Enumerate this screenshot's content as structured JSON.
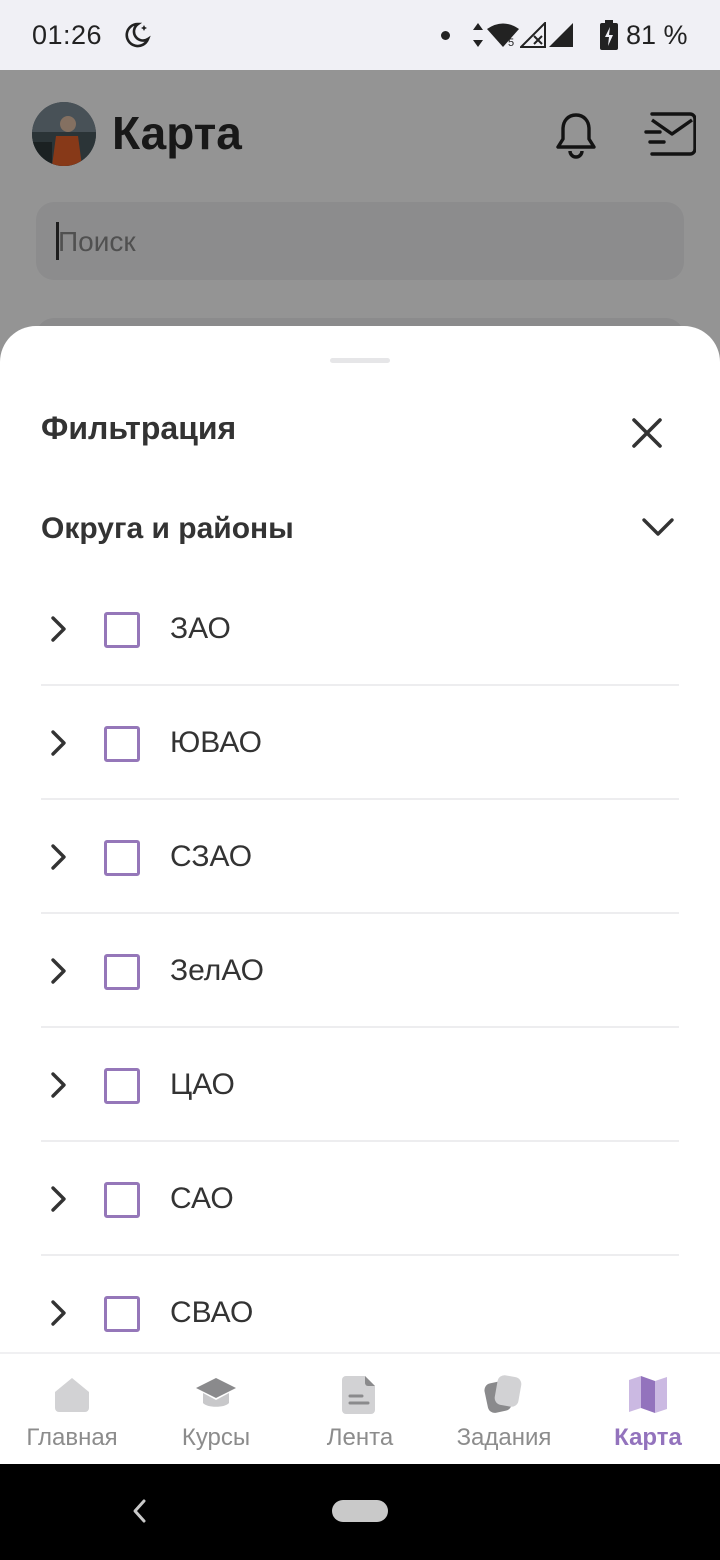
{
  "status_bar": {
    "time": "01:26",
    "battery": "81 %"
  },
  "header": {
    "title": "Карта",
    "avatar_icon": "user-avatar",
    "notifications_icon": "bell-icon",
    "messages_icon": "mail-icon"
  },
  "search": {
    "placeholder": "Поиск"
  },
  "filter_sheet": {
    "title": "Фильтрация",
    "close_icon": "close-icon",
    "section": {
      "title": "Округа и районы",
      "expanded": true
    },
    "districts": [
      {
        "label": "ЗАО",
        "checked": false
      },
      {
        "label": "ЮВАО",
        "checked": false
      },
      {
        "label": "СЗАО",
        "checked": false
      },
      {
        "label": "ЗелАО",
        "checked": false
      },
      {
        "label": "ЦАО",
        "checked": false
      },
      {
        "label": "САО",
        "checked": false
      },
      {
        "label": "СВАО",
        "checked": false
      }
    ]
  },
  "bottom_nav": {
    "items": [
      {
        "label": "Главная",
        "icon": "home-icon",
        "active": false
      },
      {
        "label": "Курсы",
        "icon": "graduation-cap-icon",
        "active": false
      },
      {
        "label": "Лента",
        "icon": "document-icon",
        "active": false
      },
      {
        "label": "Задания",
        "icon": "cards-icon",
        "active": false
      },
      {
        "label": "Карта",
        "icon": "map-icon",
        "active": true
      }
    ]
  },
  "colors": {
    "accent": "#9373bd",
    "checkbox_border": "#9577b9",
    "text_primary": "#333333",
    "nav_inactive": "#8c8c8c"
  }
}
